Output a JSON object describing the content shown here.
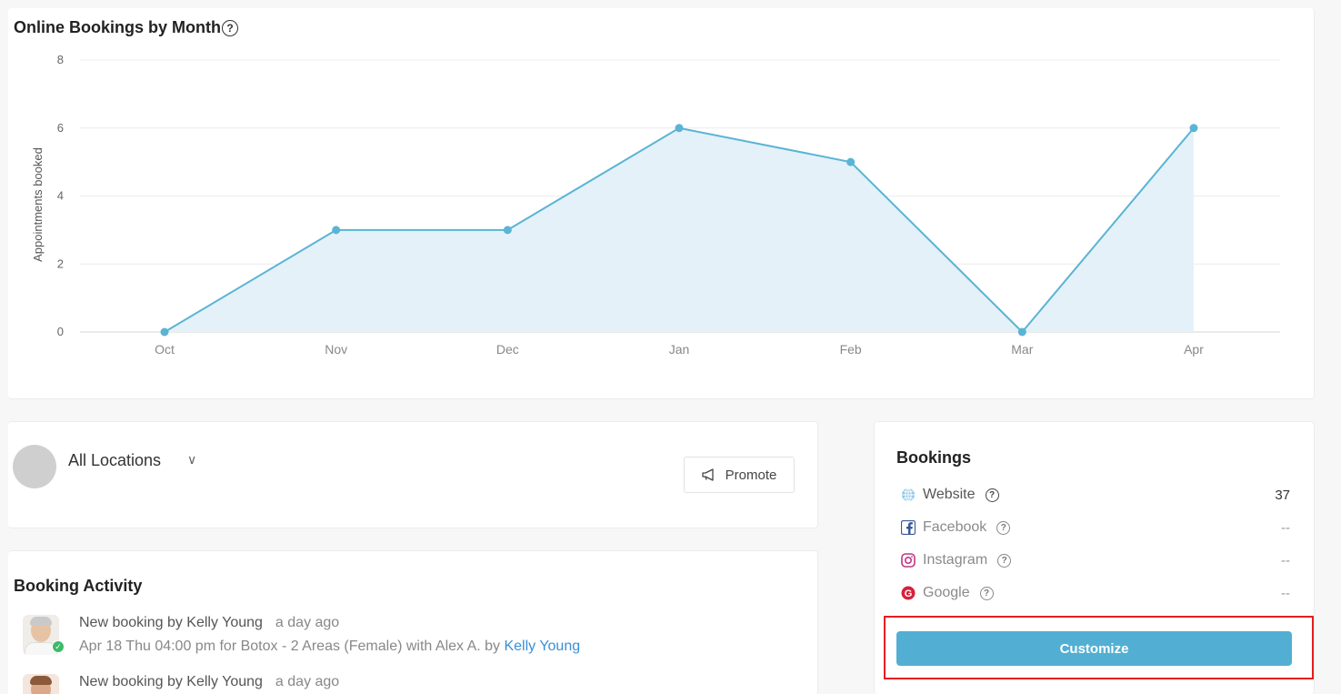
{
  "chart_card": {
    "title": "Online Bookings by Month",
    "help_icon": "question-circle-icon"
  },
  "chart_data": {
    "type": "area",
    "title": "Online Bookings by Month",
    "xlabel": "",
    "ylabel": "Appointments booked",
    "categories": [
      "Oct",
      "Nov",
      "Dec",
      "Jan",
      "Feb",
      "Mar",
      "Apr"
    ],
    "values": [
      0,
      3,
      3,
      6,
      5,
      0,
      6
    ],
    "ylim": [
      0,
      8
    ],
    "yticks": [
      0,
      2,
      4,
      6,
      8
    ],
    "grid": true,
    "colors": {
      "line": "#5ab4d4",
      "fill": "#e4f1f9",
      "grid": "#ececec",
      "tick": "#888888"
    }
  },
  "location": {
    "name": "All Locations",
    "chevron_icon": "chevron-down-icon",
    "promote_label": "Promote",
    "promote_icon": "megaphone-icon"
  },
  "activity": {
    "title": "Booking Activity",
    "items": [
      {
        "line1": "New booking by Kelly Young",
        "time": "a day ago",
        "line2_prefix": "Apr 18 Thu 04:00 pm for Botox - 2 Areas (Female) with Alex A. by ",
        "line2_link": "Kelly Young"
      },
      {
        "line1": "New booking by Kelly Young",
        "time": "a day ago",
        "line2_prefix": "",
        "line2_link": ""
      }
    ]
  },
  "bookings": {
    "title": "Bookings",
    "sources": [
      {
        "label": "Website",
        "count": "37",
        "icon": "globe-icon"
      },
      {
        "label": "Facebook",
        "count": "--",
        "icon": "facebook-icon"
      },
      {
        "label": "Instagram",
        "count": "--",
        "icon": "instagram-icon"
      },
      {
        "label": "Google",
        "count": "--",
        "icon": "google-icon"
      }
    ],
    "customize_label": "Customize"
  },
  "colors": {
    "accent": "#52afd3",
    "highlight": "#e51f1f",
    "link": "#3b8fd6"
  }
}
